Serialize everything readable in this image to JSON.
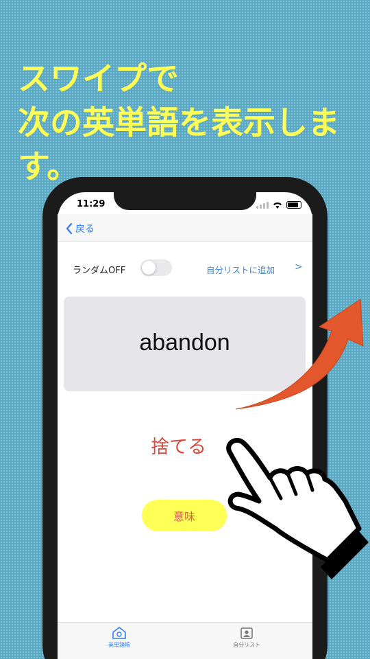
{
  "promo": {
    "line1": "スワイプで",
    "line2": "次の英単語を表示しま",
    "line3": "す。"
  },
  "status_bar": {
    "time": "11:29"
  },
  "nav": {
    "back_label": "戻る",
    "back_icon": "chevron-left-icon"
  },
  "controls": {
    "random_label": "ランダムOFF",
    "random_on": false,
    "add_to_list_label": "自分リストに追加",
    "add_to_list_chevron": ">"
  },
  "card": {
    "word": "abandon"
  },
  "meaning": {
    "text": "捨てる",
    "button_label": "意味"
  },
  "tabs": [
    {
      "label": "英単語帳",
      "icon": "house-icon",
      "active": true
    },
    {
      "label": "自分リスト",
      "icon": "id-card-icon",
      "active": false
    }
  ],
  "colors": {
    "background": "#5aa9c4",
    "promo_text": "#ffff55",
    "accent_blue": "#2f7cf6",
    "meaning_red": "#d9483b",
    "button_yellow": "#ffff55",
    "arrow_orange": "#e2572c"
  }
}
